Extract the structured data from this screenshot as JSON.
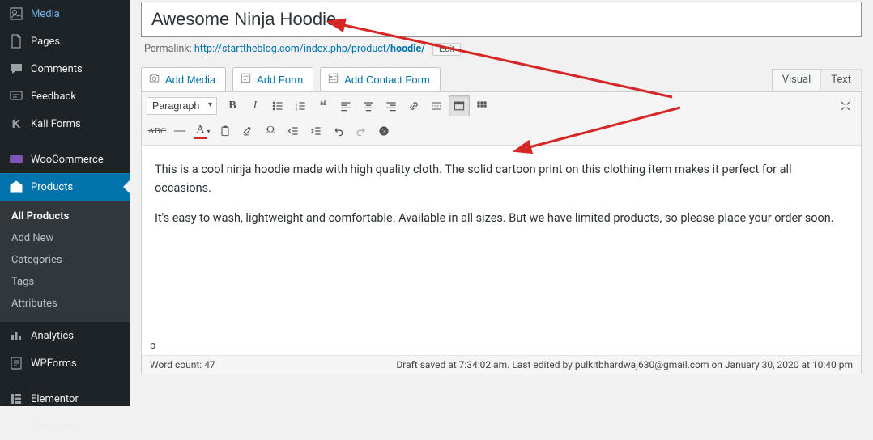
{
  "sidebar": {
    "items": [
      {
        "label": "Media"
      },
      {
        "label": "Pages"
      },
      {
        "label": "Comments"
      },
      {
        "label": "Feedback"
      },
      {
        "label": "Kali Forms"
      },
      {
        "label": "WooCommerce"
      },
      {
        "label": "Products"
      },
      {
        "label": "Analytics"
      },
      {
        "label": "WPForms"
      },
      {
        "label": "Elementor"
      },
      {
        "label": "Templates"
      }
    ],
    "products_sub": [
      {
        "label": "All Products"
      },
      {
        "label": "Add New"
      },
      {
        "label": "Categories"
      },
      {
        "label": "Tags"
      },
      {
        "label": "Attributes"
      }
    ]
  },
  "title": {
    "value": "Awesome Ninja Hoodie"
  },
  "permalink": {
    "label": "Permalink:",
    "base": "http://starttheblog.com/index.php/product/",
    "slug": "hoodie/",
    "edit": "Edit"
  },
  "media_buttons": {
    "add_media": "Add Media",
    "add_form": "Add Form",
    "add_contact_form": "Add Contact Form"
  },
  "tabs": {
    "visual": "Visual",
    "text": "Text"
  },
  "toolbar": {
    "paragraph": "Paragraph"
  },
  "content": {
    "p1": "This is a cool ninja hoodie made with high quality cloth. The solid cartoon print on this clothing item makes it perfect for all occasions.",
    "p2": "It's easy to wash, lightweight and comfortable. Available in all sizes. But we have limited products, so please place your order soon."
  },
  "status": {
    "path": "p",
    "wordcount_label": "Word count: ",
    "wordcount_value": "47",
    "draft": "Draft saved at 7:34:02 am. Last edited by pulkitbhardwaj630@gmail.com on January 30, 2020 at 10:40 pm"
  },
  "colors": {
    "arrow": "#d62727"
  }
}
